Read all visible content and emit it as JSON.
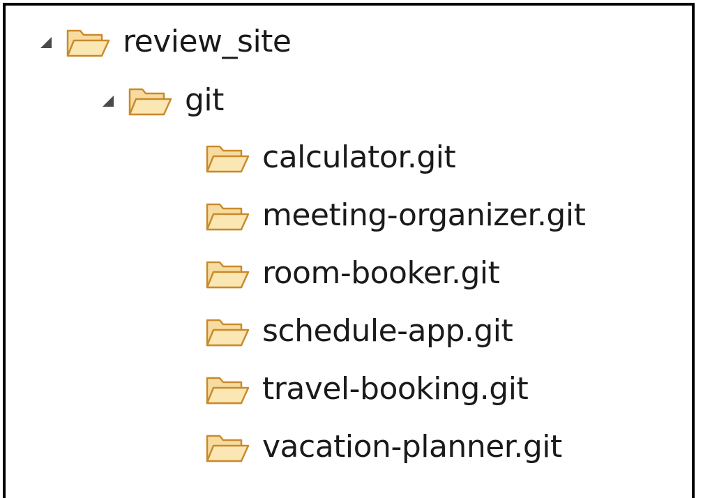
{
  "tree": {
    "root": {
      "label": "review_site",
      "expanded": true,
      "icon": "folder-open-icon",
      "children": [
        {
          "label": "git",
          "expanded": true,
          "icon": "folder-open-icon",
          "children": [
            {
              "label": "calculator.git",
              "icon": "folder-open-icon"
            },
            {
              "label": "meeting-organizer.git",
              "icon": "folder-open-icon"
            },
            {
              "label": "room-booker.git",
              "icon": "folder-open-icon"
            },
            {
              "label": "schedule-app.git",
              "icon": "folder-open-icon"
            },
            {
              "label": "travel-booking.git",
              "icon": "folder-open-icon"
            },
            {
              "label": "vacation-planner.git",
              "icon": "folder-open-icon"
            }
          ]
        }
      ]
    }
  },
  "colors": {
    "folder_fill": "#f6dca0",
    "folder_stroke": "#c98a2c",
    "twisty": "#4a4a4a"
  }
}
